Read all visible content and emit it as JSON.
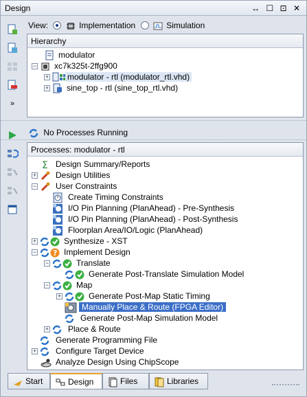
{
  "window": {
    "title": "Design",
    "controls": "↔ ☐ ⊡ ✕"
  },
  "view": {
    "label": "View:",
    "options": [
      {
        "label": "Implementation",
        "selected": true
      },
      {
        "label": "Simulation",
        "selected": false
      }
    ]
  },
  "hierarchy": {
    "header": "Hierarchy",
    "items": [
      {
        "label": "modulator",
        "icon": "doc-icon"
      },
      {
        "label": "xc7k325t-2ffg900",
        "icon": "chip-icon",
        "expanded": true
      },
      {
        "label": "modulator - rtl (modulator_rtl.vhd)",
        "icon": "vhdl-module-icon",
        "selected": true
      },
      {
        "label": "sine_top - rtl (sine_top_rtl.vhd)",
        "icon": "vhdl-module-icon"
      }
    ]
  },
  "processes_status": "No Processes Running",
  "processes": {
    "header": "Processes: modulator - rtl",
    "items": [
      {
        "label": "Design Summary/Reports",
        "icon": "sigma-icon",
        "depth": 0
      },
      {
        "label": "Design Utilities",
        "icon": "tools-icon",
        "depth": 0,
        "expander": "+"
      },
      {
        "label": "User Constraints",
        "icon": "tools-icon",
        "depth": 0,
        "expander": "−"
      },
      {
        "label": "Create Timing Constraints",
        "icon": "clock-icon",
        "depth": 1
      },
      {
        "label": "I/O Pin Planning (PlanAhead) - Pre-Synthesis",
        "icon": "planahead-icon",
        "depth": 1
      },
      {
        "label": "I/O Pin Planning (PlanAhead) - Post-Synthesis",
        "icon": "planahead-icon",
        "depth": 1
      },
      {
        "label": "Floorplan Area/IO/Logic (PlanAhead)",
        "icon": "planahead-icon",
        "depth": 1
      },
      {
        "label": "Synthesize - XST",
        "icon": "run-ok-icon",
        "depth": 0,
        "expander": "+"
      },
      {
        "label": "Implement Design",
        "icon": "run-warn-icon",
        "depth": 0,
        "expander": "−"
      },
      {
        "label": "Translate",
        "icon": "run-ok-icon",
        "depth": 1,
        "expander": "−"
      },
      {
        "label": "Generate Post-Translate Simulation Model",
        "icon": "run-ok-icon",
        "depth": 2
      },
      {
        "label": "Map",
        "icon": "run-ok-icon",
        "depth": 1,
        "expander": "−"
      },
      {
        "label": "Generate Post-Map Static Timing",
        "icon": "run-ok-icon",
        "depth": 2,
        "expander": "+"
      },
      {
        "label": "Manually Place & Route (FPGA Editor)",
        "icon": "fpga-editor-icon",
        "depth": 2,
        "selected": true
      },
      {
        "label": "Generate Post-Map Simulation Model",
        "icon": "run-icon",
        "depth": 2
      },
      {
        "label": "Place & Route",
        "icon": "run-icon",
        "depth": 1,
        "expander": "+"
      },
      {
        "label": "Generate Programming File",
        "icon": "run-icon",
        "depth": 0
      },
      {
        "label": "Configure Target Device",
        "icon": "run-icon",
        "depth": 0,
        "expander": "+"
      },
      {
        "label": "Analyze Design Using ChipScope",
        "icon": "chipscope-icon",
        "depth": 0
      }
    ]
  },
  "tabs": [
    {
      "label": "Start",
      "icon": "start-icon"
    },
    {
      "label": "Design",
      "icon": "design-icon",
      "active": true
    },
    {
      "label": "Files",
      "icon": "files-icon"
    },
    {
      "label": "Libraries",
      "icon": "libraries-icon"
    }
  ],
  "colors": {
    "selection": "#3c6fc8",
    "ok": "#3cb043",
    "run": "#2a74c9",
    "warn": "#f08a1e"
  }
}
